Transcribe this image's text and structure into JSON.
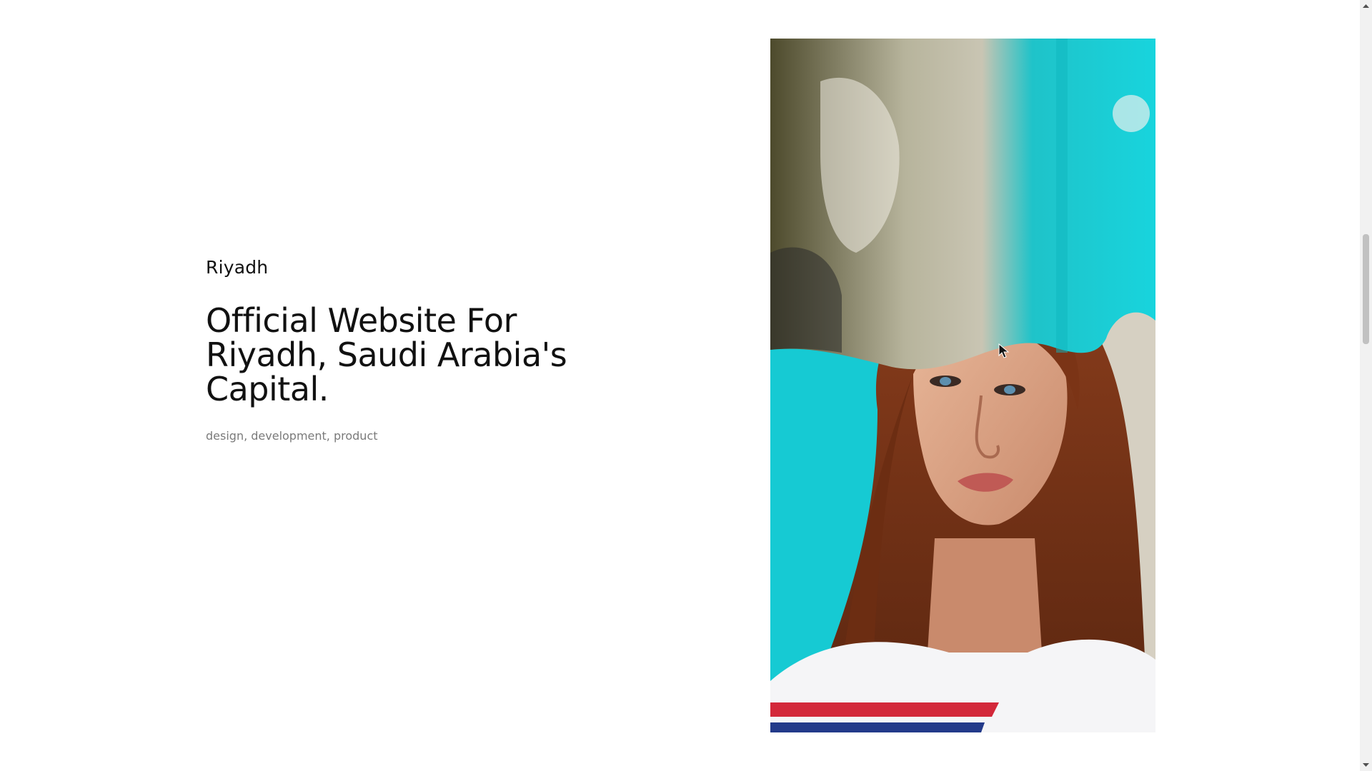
{
  "project": {
    "city": "Riyadh",
    "headline": "Official Website For Riyadh, Saudi Arabia's Capital.",
    "tags": [
      "design",
      "development",
      "product"
    ]
  },
  "media": {
    "icon": "portrait-photo-icon",
    "accent": "#1ccfd8"
  }
}
